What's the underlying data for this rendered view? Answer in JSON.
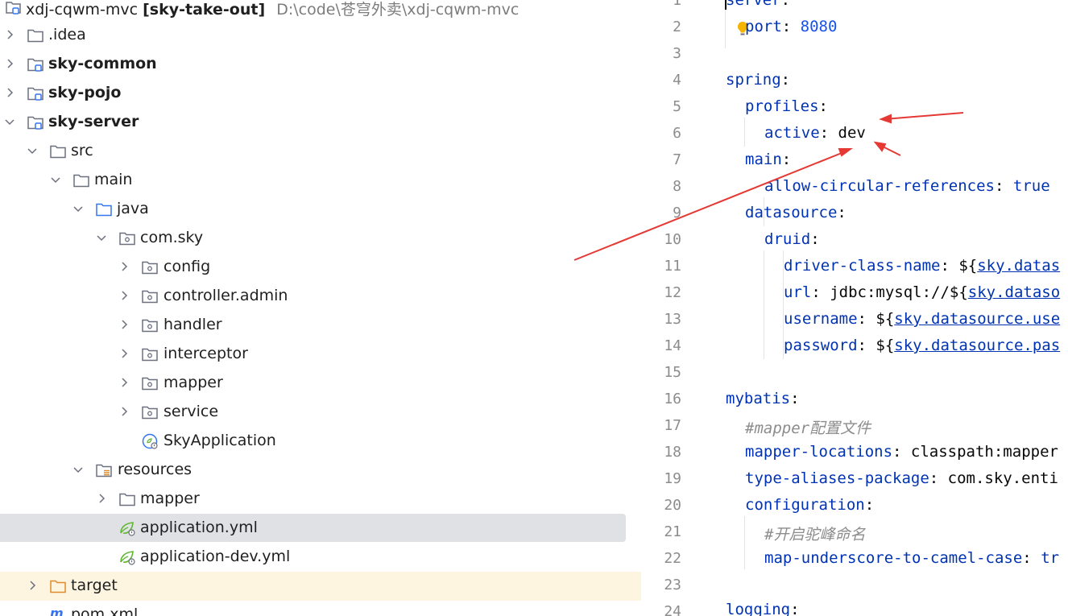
{
  "project_tree": {
    "root": {
      "name": "xdj-cqwm-mvc",
      "module": "[sky-take-out]",
      "path": "D:\\code\\苍穹外卖\\xdj-cqwm-mvc"
    },
    "items": [
      {
        "label": "root"
      },
      {
        "label": ".idea"
      },
      {
        "label": "sky-common"
      },
      {
        "label": "sky-pojo"
      },
      {
        "label": "sky-server"
      },
      {
        "label": "src"
      },
      {
        "label": "main"
      },
      {
        "label": "java"
      },
      {
        "label": "com.sky"
      },
      {
        "label": "config"
      },
      {
        "label": "controller.admin"
      },
      {
        "label": "handler"
      },
      {
        "label": "interceptor"
      },
      {
        "label": "mapper"
      },
      {
        "label": "service"
      },
      {
        "label": "SkyApplication"
      },
      {
        "label": "resources"
      },
      {
        "label": "mapper"
      },
      {
        "label": "application.yml"
      },
      {
        "label": "application-dev.yml"
      },
      {
        "label": "target"
      },
      {
        "label": "pom.xml"
      }
    ]
  },
  "editor": {
    "file": "application.yml",
    "lines": [
      {
        "n": "1",
        "key": "server",
        "sep": ":",
        "val": ""
      },
      {
        "n": "2",
        "key": "port",
        "sep": ": ",
        "val": "8080"
      },
      {
        "n": "3",
        "key": "",
        "sep": "",
        "val": ""
      },
      {
        "n": "4",
        "key": "spring",
        "sep": ":",
        "val": ""
      },
      {
        "n": "5",
        "key": "profiles",
        "sep": ":",
        "val": ""
      },
      {
        "n": "6",
        "key": "active",
        "sep": ": ",
        "val": "dev"
      },
      {
        "n": "7",
        "key": "main",
        "sep": ":",
        "val": ""
      },
      {
        "n": "8",
        "key": "allow-circular-references",
        "sep": ": ",
        "val": "true"
      },
      {
        "n": "9",
        "key": "datasource",
        "sep": ":",
        "val": ""
      },
      {
        "n": "10",
        "key": "druid",
        "sep": ":",
        "val": ""
      },
      {
        "n": "11",
        "key": "driver-class-name",
        "sep": ": ${",
        "val": "sky.datas"
      },
      {
        "n": "12",
        "key": "url",
        "sep": ": jdbc:mysql://${",
        "val": "sky.dataso"
      },
      {
        "n": "13",
        "key": "username",
        "sep": ": ${",
        "val": "sky.datasource.use"
      },
      {
        "n": "14",
        "key": "password",
        "sep": ": ${",
        "val": "sky.datasource.pas"
      },
      {
        "n": "15",
        "key": "",
        "sep": "",
        "val": ""
      },
      {
        "n": "16",
        "key": "mybatis",
        "sep": ":",
        "val": ""
      },
      {
        "n": "17",
        "comment": "#mapper配置文件"
      },
      {
        "n": "18",
        "key": "mapper-locations",
        "sep": ": ",
        "val": "classpath:mapper"
      },
      {
        "n": "19",
        "key": "type-aliases-package",
        "sep": ": ",
        "val": "com.sky.enti"
      },
      {
        "n": "20",
        "key": "configuration",
        "sep": ":",
        "val": ""
      },
      {
        "n": "21",
        "comment": "#开启驼峰命名"
      },
      {
        "n": "22",
        "key": "map-underscore-to-camel-case",
        "sep": ": ",
        "val": "tr"
      },
      {
        "n": "23",
        "key": "",
        "sep": "",
        "val": ""
      },
      {
        "n": "24",
        "key": "logging",
        "sep": ":",
        "val": ""
      }
    ]
  },
  "colors": {
    "selection": "#dfe1e5",
    "excluded": "#fdf5e0",
    "key": "#0033b3",
    "number": "#1750eb",
    "arrow": "#e53935"
  },
  "icons": [
    "folder-icon",
    "module-folder-icon",
    "package-icon",
    "resources-folder-icon",
    "spring-boot-app-icon",
    "spring-yaml-icon",
    "maven-icon",
    "bulb-icon"
  ]
}
